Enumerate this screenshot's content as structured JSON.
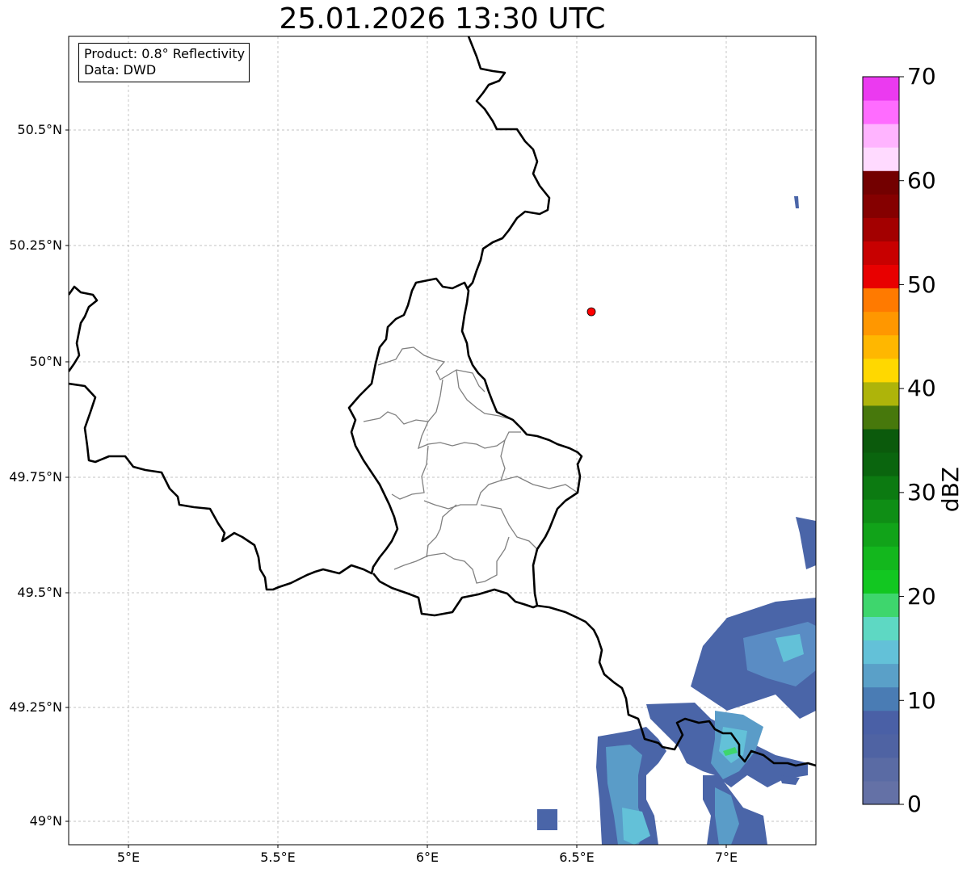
{
  "title": "25.01.2026 13:30 UTC",
  "info": {
    "product": "Product: 0.8° Reflectivity",
    "source": "Data: DWD"
  },
  "axes": {
    "y_ticks": [
      "50.5°N",
      "50.25°N",
      "50°N",
      "49.75°N",
      "49.5°N",
      "49.25°N",
      "49°N"
    ],
    "x_ticks": [
      "5°E",
      "5.5°E",
      "6°E",
      "6.5°E",
      "7°E"
    ],
    "lon_range": [
      4.8,
      7.3
    ],
    "lat_range": [
      48.95,
      50.7
    ]
  },
  "marker": {
    "lon": 6.55,
    "lat": 50.11,
    "color": "#ff0000"
  },
  "colorbar": {
    "unit": "dBZ",
    "ticks": [
      "0",
      "10",
      "20",
      "30",
      "40",
      "50",
      "60",
      "70"
    ],
    "range": [
      0,
      70
    ],
    "colors": [
      "#6471a6",
      "#5a6ba4",
      "#4f63a3",
      "#4a60a6",
      "#4a7cb4",
      "#5aa0c8",
      "#63c1d8",
      "#5ed8c3",
      "#3ed66d",
      "#12c721",
      "#13b71d",
      "#11a319",
      "#0f8e15",
      "#0c7a11",
      "#0a650e",
      "#0b5a0c",
      "#47780c",
      "#aeb40a",
      "#ffd800",
      "#ffb700",
      "#ff9700",
      "#ff7a00",
      "#e80000",
      "#c80000",
      "#a30000",
      "#850000",
      "#730000",
      "#ffdaff",
      "#ffb4ff",
      "#ff6cff",
      "#eb3af0"
    ]
  }
}
